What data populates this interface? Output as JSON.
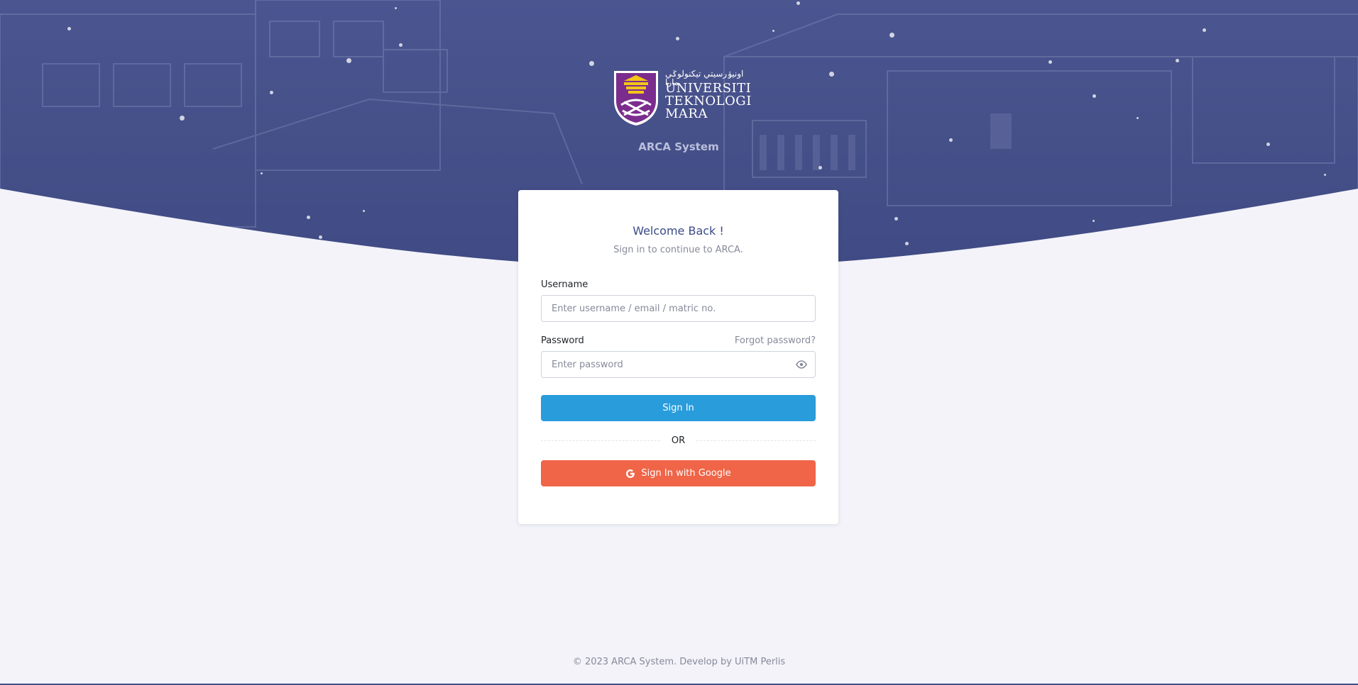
{
  "brand": {
    "logo_jawi": "اونيۏرسيتي تيكنولوݢي مارا",
    "logo_lines": [
      "UNIVERSITI",
      "TEKNOLOGI",
      "MARA"
    ],
    "system_name": "ARCA System"
  },
  "login": {
    "title": "Welcome Back !",
    "subtitle": "Sign in to continue to ARCA.",
    "username_label": "Username",
    "username_placeholder": "Enter username / email / matric no.",
    "username_value": "",
    "password_label": "Password",
    "forgot_label": "Forgot password?",
    "password_placeholder": "Enter password",
    "password_value": "",
    "signin_label": "Sign In",
    "or_label": "OR",
    "google_label": "Sign In with Google"
  },
  "footer": {
    "text": "© 2023 ARCA System. Develop by UiTM Perlis"
  },
  "colors": {
    "hero": "#465089",
    "page_bg": "#f3f3f9",
    "title": "#3b4a86",
    "signin_button": "#299cdb",
    "google_button": "#f06548"
  },
  "icons": {
    "crest": "uitm-crest-icon",
    "password_toggle": "eye-icon",
    "google": "google-g-icon"
  }
}
